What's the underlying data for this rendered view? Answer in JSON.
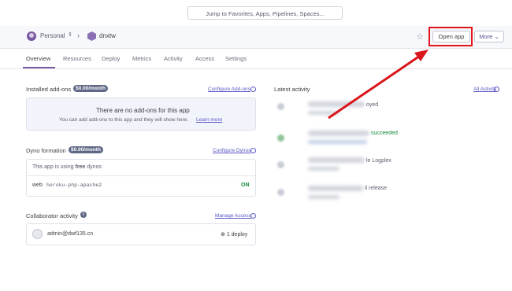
{
  "top": {
    "search_placeholder": "Jump to Favorites, Apps, Pipelines, Spaces..."
  },
  "header": {
    "team": "Personal",
    "app": "dnxtw",
    "open_app": "Open app",
    "more": "More"
  },
  "tabs": [
    "Overview",
    "Resources",
    "Deploy",
    "Metrics",
    "Activity",
    "Access",
    "Settings"
  ],
  "addons": {
    "title": "Installed add-ons",
    "cost": "$0.00/month",
    "configure": "Configure Add-ons",
    "empty_title": "There are no add-ons for this app",
    "empty_desc": "You can add add-ons to this app and they will show here.",
    "learn_more": "Learn more"
  },
  "dyno": {
    "title": "Dyno formation",
    "cost": "$0.00/month",
    "configure": "Configure Dynos",
    "using_prefix": "This app is using",
    "using_bold": "free",
    "using_suffix": "dynos",
    "type": "web",
    "command": "heroku-php-apache2",
    "status": "ON"
  },
  "collab": {
    "title": "Collaborator activity",
    "manage": "Manage Access",
    "email": "admin@dwf135.cn",
    "deploys": "1 deploy"
  },
  "activity": {
    "title": "Latest activity",
    "all": "All Activity",
    "items": [
      "oyed",
      "succeeded",
      "le Logplex",
      "il release"
    ]
  },
  "colors": {
    "accent": "#79589f",
    "highlight": "#e1151a",
    "success": "#168a3a"
  }
}
